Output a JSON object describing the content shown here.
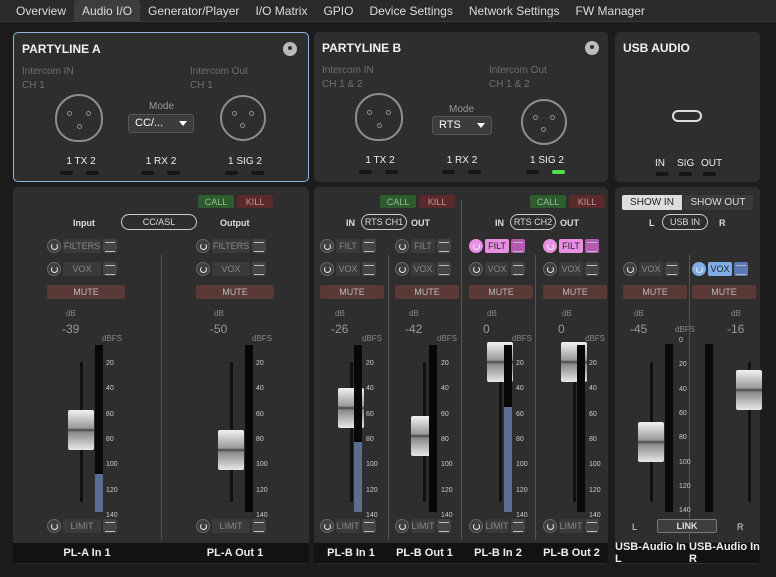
{
  "tabs": [
    "Overview",
    "Audio I/O",
    "Generator/Player",
    "I/O Matrix",
    "GPIO",
    "Device Settings",
    "Network Settings",
    "FW Manager"
  ],
  "partyline_a": {
    "title": "PARTYLINE A",
    "intercom_in": "Intercom IN",
    "intercom_in_ch": "CH 1",
    "intercom_out": "Intercom Out",
    "intercom_out_ch": "CH 1",
    "mode_label": "Mode",
    "mode_value": "CC/...",
    "tx": "TX",
    "rx": "RX",
    "sig": "SIG",
    "n1": "1",
    "n2": "2"
  },
  "partyline_b": {
    "title": "PARTYLINE B",
    "intercom_in": "Intercom IN",
    "intercom_in_ch": "CH 1 & 2",
    "intercom_out": "Intercom Out",
    "intercom_out_ch": "CH 1 & 2",
    "mode_label": "Mode",
    "mode_value": "RTS",
    "tx": "TX",
    "rx": "RX",
    "sig": "SIG",
    "n1": "1",
    "n2": "2"
  },
  "usb_audio": {
    "title": "USB AUDIO",
    "in": "IN",
    "sig": "SIG",
    "out": "OUT"
  },
  "labels": {
    "call": "CALL",
    "kill": "KILL",
    "filters": "FILTERS",
    "filt": "FILT",
    "vox": "VOX",
    "mute": "MUTE",
    "limit": "LIMIT",
    "db": "dB",
    "dbfs": "dBFS",
    "input": "Input",
    "output": "Output",
    "in": "IN",
    "out": "OUT",
    "cc_asl": "CC/ASL",
    "rts_ch1": "RTS CH1",
    "rts_ch2": "RTS CH2",
    "show_in": "SHOW IN",
    "show_out": "SHOW OUT",
    "usb_in": "USB IN",
    "l": "L",
    "r": "R",
    "link": "LINK"
  },
  "scale_ticks": [
    "20",
    "40",
    "60",
    "80",
    "100",
    "120",
    "140"
  ],
  "scale_ticks_usb": [
    "0",
    "20",
    "40",
    "60",
    "80",
    "100",
    "120",
    "140"
  ],
  "channels": [
    {
      "name": "PL-A In 1",
      "value": "-39",
      "level": 0.0,
      "meter": 0.23
    },
    {
      "name": "PL-A Out 1",
      "value": "-50",
      "level": 0.0,
      "meter": 0.0
    },
    {
      "name": "PL-B In 1",
      "value": "-26",
      "level": 0.0,
      "meter": 0.42
    },
    {
      "name": "PL-B Out 1",
      "value": "-42",
      "level": 0.0,
      "meter": 0.0
    },
    {
      "name": "PL-B In 2",
      "value": "0",
      "level": 0.0,
      "meter": 0.63
    },
    {
      "name": "PL-B Out 2",
      "value": "0",
      "level": 0.0,
      "meter": 0.0
    },
    {
      "name": "USB-Audio In L",
      "value": "-45",
      "level": 0.0,
      "meter": 0.0
    },
    {
      "name": "USB-Audio In R",
      "value": "-16",
      "level": 0.0,
      "meter": 0.0
    }
  ]
}
